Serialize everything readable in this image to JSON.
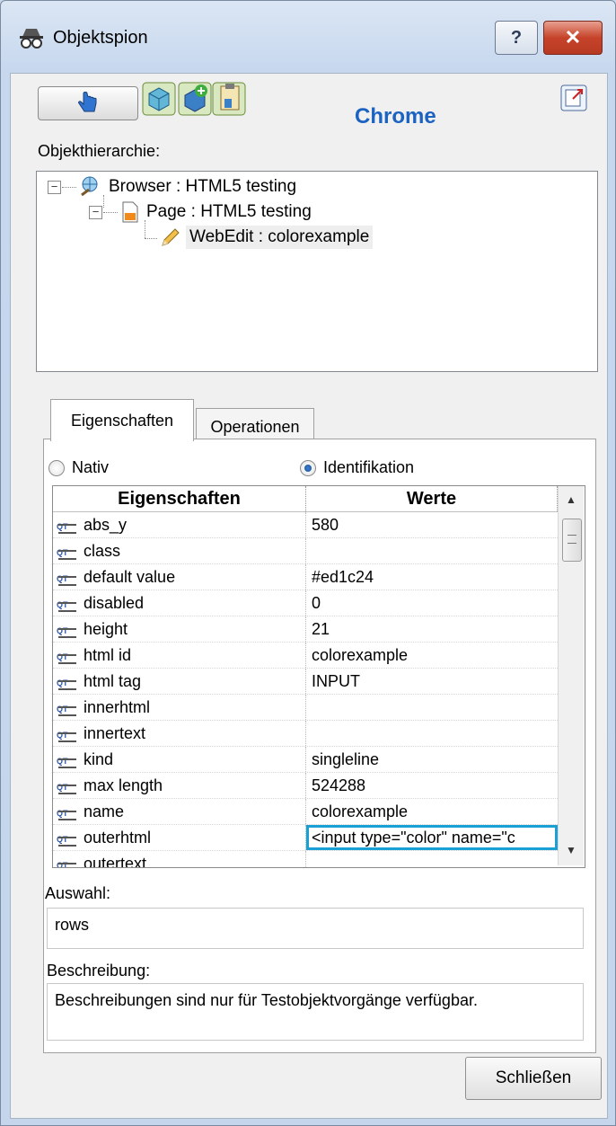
{
  "window": {
    "title": "Objektspion",
    "help_label": "?",
    "close_label": "✕"
  },
  "toolbar": {
    "browser_name": "Chrome",
    "icons": [
      "hand-pointer-icon",
      "object-icon",
      "add-to-repository-icon",
      "highlight-icon",
      "report-icon"
    ]
  },
  "hierarchy": {
    "label": "Objekthierarchie:",
    "nodes": [
      {
        "text": "Browser : HTML5 testing",
        "icon": "browser-icon",
        "level": 0
      },
      {
        "text": "Page : HTML5 testing",
        "icon": "page-icon",
        "level": 1
      },
      {
        "text": "WebEdit : colorexample",
        "icon": "pencil-icon",
        "level": 2,
        "selected": true
      }
    ]
  },
  "tabs": {
    "properties": "Eigenschaften",
    "operations": "Operationen"
  },
  "mode": {
    "native": "Nativ",
    "identification": "Identifikation",
    "selected": "identification"
  },
  "grid": {
    "headers": [
      "Eigenschaften",
      "Werte"
    ],
    "icon_text": "QT",
    "rows": [
      {
        "name": "abs_y",
        "value": "580"
      },
      {
        "name": "class",
        "value": ""
      },
      {
        "name": "default value",
        "value": "#ed1c24"
      },
      {
        "name": "disabled",
        "value": "0"
      },
      {
        "name": "height",
        "value": "21"
      },
      {
        "name": "html id",
        "value": "colorexample"
      },
      {
        "name": "html tag",
        "value": "INPUT"
      },
      {
        "name": "innerhtml",
        "value": ""
      },
      {
        "name": "innertext",
        "value": ""
      },
      {
        "name": "kind",
        "value": "singleline"
      },
      {
        "name": "max length",
        "value": "524288"
      },
      {
        "name": "name",
        "value": "colorexample"
      },
      {
        "name": "outerhtml",
        "value": "<input type=\"color\" name=\"c",
        "selected": true
      },
      {
        "name": "outertext",
        "value": ""
      }
    ]
  },
  "selection": {
    "label": "Auswahl:",
    "value": "rows"
  },
  "description": {
    "label": "Beschreibung:",
    "value": "Beschreibungen sind nur für Testobjektvorgänge verfügbar."
  },
  "footer": {
    "close_button": "Schließen"
  }
}
